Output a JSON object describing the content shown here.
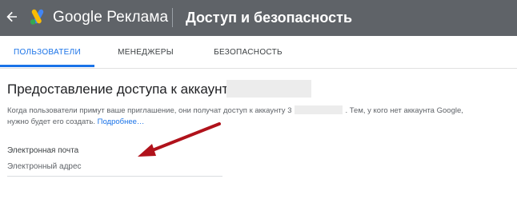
{
  "header": {
    "brand": "Google Реклама",
    "page_title": "Доступ и безопасность",
    "icons": [
      "arrow-back-icon",
      "google-ads-logo"
    ],
    "background_color": "#5f6368"
  },
  "tabs": [
    {
      "label": "ПОЛЬЗОВАТЕЛИ",
      "active": true
    },
    {
      "label": "МЕНЕДЖЕРЫ",
      "active": false
    },
    {
      "label": "БЕЗОПАСНОСТЬ",
      "active": false
    }
  ],
  "accent_color": "#1a73e8",
  "section": {
    "title": "Предоставление доступа к аккаунту",
    "desc_part1": "Когда пользователи примут ваше приглашение, они получат доступ к аккаунту",
    "desc_part1_tail": "3",
    "desc_part2": ". Тем, у кого нет аккаунта Google,",
    "desc_line2": "нужно будет его создать.",
    "link": "Подробнее…"
  },
  "form": {
    "email_label": "Электронная почта",
    "email_placeholder": "Электронный адрес",
    "email_value": ""
  },
  "annotation": {
    "type": "arrow",
    "color": "#b0121b",
    "target": "email-field"
  }
}
